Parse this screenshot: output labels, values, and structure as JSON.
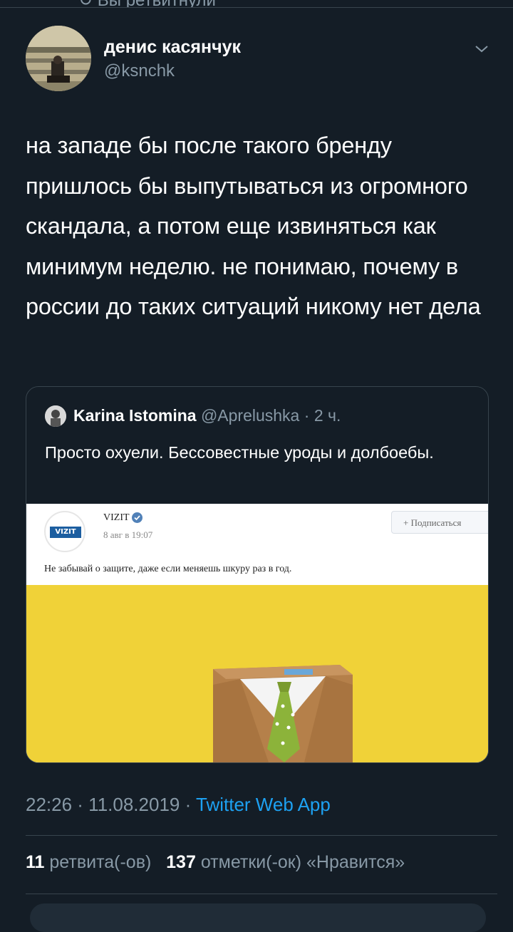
{
  "author": {
    "name": "денис касянчук",
    "handle": "@ksnchk"
  },
  "tweet": {
    "text": "на западе бы после такого бренду пришлось бы выпутываться из огромного скандала, а потом еще извиняться как минимум неделю. не понимаю, почему в россии до таких ситуаций никому нет дела",
    "timestamp": "22:26 · 11.08.2019 · ",
    "source": "Twitter Web App"
  },
  "quoted": {
    "name": "Karina Istomina",
    "handle": "@Aprelushka",
    "time": "2 ч.",
    "text": "Просто охуели. Бессовестные уроды и долбоебы.",
    "media": {
      "brand_logo": "VIZIT",
      "brand_name": "VIZIT",
      "date": "8 авг в 19:07",
      "subscribe_label": "+ Подписаться",
      "post_text": "Не забывай о защите, даже если меняешь шкуру раз в год.",
      "background_color": "#f0d238"
    }
  },
  "stats": {
    "retweets_count": "11",
    "retweets_label": "ретвита(-ов)",
    "likes_count": "137",
    "likes_label": "отметки(-ок) «Нравится»"
  },
  "colors": {
    "background": "#141d26",
    "secondary_text": "#8899a6",
    "link": "#1da1f2",
    "border": "#38444d"
  }
}
